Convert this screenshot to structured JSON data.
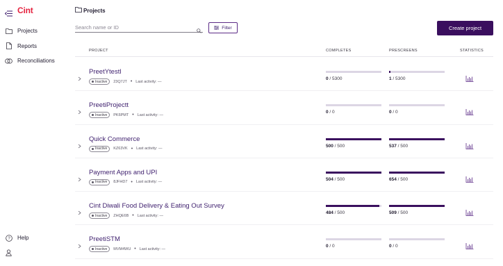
{
  "app": {
    "logo": "Cint"
  },
  "sidebar": {
    "items": [
      {
        "label": "Projects",
        "icon": "folder-icon"
      },
      {
        "label": "Reports",
        "icon": "document-icon"
      },
      {
        "label": "Reconciliations",
        "icon": "coins-icon"
      }
    ],
    "bottom": [
      {
        "label": "Help",
        "icon": "help-icon"
      },
      {
        "label": "",
        "icon": "user-icon"
      }
    ]
  },
  "header": {
    "breadcrumb": "Projects"
  },
  "toolbar": {
    "search_placeholder": "Search name or ID",
    "filter_label": "Filter",
    "create_label": "Create project"
  },
  "table": {
    "headers": {
      "project": "PROJECT",
      "completes": "COMPLETES",
      "prescreens": "PRESCREENS",
      "statistics": "STATISTICS"
    },
    "rows": [
      {
        "name": "PreetYtestl",
        "status": "Inactive",
        "id": "23Q7JT",
        "activity": "Last activity: —",
        "completes": "0",
        "completes_total": " / 5300",
        "completes_pct": 0,
        "prescreens": "1",
        "prescreens_total": " / 5300",
        "prescreens_pct": 0.02
      },
      {
        "name": "PreetiProjectt",
        "status": "Inactive",
        "id": "PK6PMT",
        "activity": "Last activity: —",
        "completes": "0",
        "completes_total": " / 0",
        "completes_pct": 0,
        "prescreens": "0",
        "prescreens_total": " / 0",
        "prescreens_pct": 0
      },
      {
        "name": "Quick Commerce",
        "status": "Inactive",
        "id": "KZ63VK",
        "activity": "Last activity: —",
        "completes": "500",
        "completes_total": " / 500",
        "completes_pct": 1,
        "prescreens": "537",
        "prescreens_total": " / 500",
        "prescreens_pct": 1
      },
      {
        "name": "Payment Apps and UPI",
        "status": "Inactive",
        "id": "8JFHD7",
        "activity": "Last activity: —",
        "completes": "504",
        "completes_total": " / 500",
        "completes_pct": 1,
        "prescreens": "654",
        "prescreens_total": " / 500",
        "prescreens_pct": 1
      },
      {
        "name": "Cint Diwali Food Delivery & Eating Out Survey",
        "status": "Inactive",
        "id": "ZHQE6B",
        "activity": "Last activity: —",
        "completes": "484",
        "completes_total": " / 500",
        "completes_pct": 0.968,
        "prescreens": "509",
        "prescreens_total": " / 500",
        "prescreens_pct": 1
      },
      {
        "name": "PreetiSTM",
        "status": "Inactive",
        "id": "MVM4WU",
        "activity": "Last activity: —",
        "completes": "0",
        "completes_total": " / 0",
        "completes_pct": 0,
        "prescreens": "0",
        "prescreens_total": " / 0",
        "prescreens_pct": 0
      }
    ]
  },
  "colors": {
    "brand": "#e5233f",
    "accent": "#3a0f5e",
    "track": "#dcd6e4"
  }
}
